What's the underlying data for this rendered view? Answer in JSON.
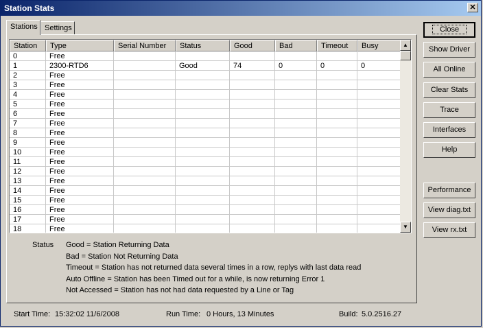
{
  "window": {
    "title": "Station Stats"
  },
  "tabs": [
    {
      "label": "Stations",
      "active": true
    },
    {
      "label": "Settings",
      "active": false
    }
  ],
  "table": {
    "columns": [
      "Station",
      "Type",
      "Serial Number",
      "Status",
      "Good",
      "Bad",
      "Timeout",
      "Busy"
    ],
    "rows": [
      [
        "0",
        "Free",
        "",
        "",
        "",
        "",
        "",
        ""
      ],
      [
        "1",
        "2300-RTD6",
        "",
        "Good",
        "74",
        "0",
        "0",
        "0"
      ],
      [
        "2",
        "Free",
        "",
        "",
        "",
        "",
        "",
        ""
      ],
      [
        "3",
        "Free",
        "",
        "",
        "",
        "",
        "",
        ""
      ],
      [
        "4",
        "Free",
        "",
        "",
        "",
        "",
        "",
        ""
      ],
      [
        "5",
        "Free",
        "",
        "",
        "",
        "",
        "",
        ""
      ],
      [
        "6",
        "Free",
        "",
        "",
        "",
        "",
        "",
        ""
      ],
      [
        "7",
        "Free",
        "",
        "",
        "",
        "",
        "",
        ""
      ],
      [
        "8",
        "Free",
        "",
        "",
        "",
        "",
        "",
        ""
      ],
      [
        "9",
        "Free",
        "",
        "",
        "",
        "",
        "",
        ""
      ],
      [
        "10",
        "Free",
        "",
        "",
        "",
        "",
        "",
        ""
      ],
      [
        "11",
        "Free",
        "",
        "",
        "",
        "",
        "",
        ""
      ],
      [
        "12",
        "Free",
        "",
        "",
        "",
        "",
        "",
        ""
      ],
      [
        "13",
        "Free",
        "",
        "",
        "",
        "",
        "",
        ""
      ],
      [
        "14",
        "Free",
        "",
        "",
        "",
        "",
        "",
        ""
      ],
      [
        "15",
        "Free",
        "",
        "",
        "",
        "",
        "",
        ""
      ],
      [
        "16",
        "Free",
        "",
        "",
        "",
        "",
        "",
        ""
      ],
      [
        "17",
        "Free",
        "",
        "",
        "",
        "",
        "",
        ""
      ],
      [
        "18",
        "Free",
        "",
        "",
        "",
        "",
        "",
        ""
      ]
    ]
  },
  "legend": {
    "label": "Status",
    "lines": [
      "Good = Station Returning Data",
      "Bad = Station Not Returning Data",
      "Timeout = Station has not returned data several times in a row, replys with last data read",
      "Auto Offline = Station has been Timed out for a while, is now returning Error 1",
      "Not Accessed = Station has not had data requested by a Line or Tag"
    ]
  },
  "buttons": {
    "close": "Close",
    "show_driver": "Show Driver",
    "all_online": "All Online",
    "clear_stats": "Clear Stats",
    "trace": "Trace",
    "interfaces": "Interfaces",
    "help": "Help",
    "performance": "Performance",
    "view_diag": "View diag.txt",
    "view_rx": "View rx.txt"
  },
  "footer": {
    "start_label": "Start Time:",
    "start_value": "15:32:02 11/6/2008",
    "run_label": "Run Time:",
    "run_value": "0 Hours, 13 Minutes",
    "build_label": "Build:",
    "build_value": "5.0.2516.27"
  }
}
